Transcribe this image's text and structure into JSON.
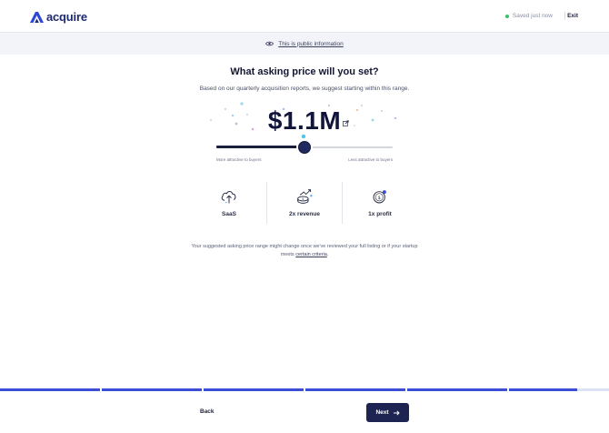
{
  "header": {
    "brand": "acquire",
    "saved_status": "Saved just now",
    "exit_label": "Exit"
  },
  "public_bar": {
    "icon": "eye-icon",
    "label": "This is public information"
  },
  "main": {
    "title": "What asking price will you set?",
    "subtitle": "Based on our quarterly acquisition reports, we suggest starting within this range.",
    "price": "$1.1M",
    "slider": {
      "value_fraction": 0.5,
      "left_label": "More attractive to buyers",
      "right_label": "Less attractive to buyers"
    },
    "stats": [
      {
        "icon": "cloud-upload-icon",
        "label": "SaaS"
      },
      {
        "icon": "money-growth-icon",
        "label": "2x revenue"
      },
      {
        "icon": "coin-icon",
        "label": "1x profit"
      }
    ],
    "note_before": "Your suggested asking price range might change once we've reviewed your full listing or if your startup meets ",
    "note_link": "certain criteria",
    "note_after": "."
  },
  "progress": {
    "segments": [
      1,
      1,
      1,
      1,
      1,
      0.68
    ],
    "color": "#3a4ed8"
  },
  "footer": {
    "back_label": "Back",
    "next_label": "Next"
  },
  "colors": {
    "brand": "#1e2a6e",
    "accent": "#3a4ed8",
    "saved_dot": "#37c26b"
  }
}
